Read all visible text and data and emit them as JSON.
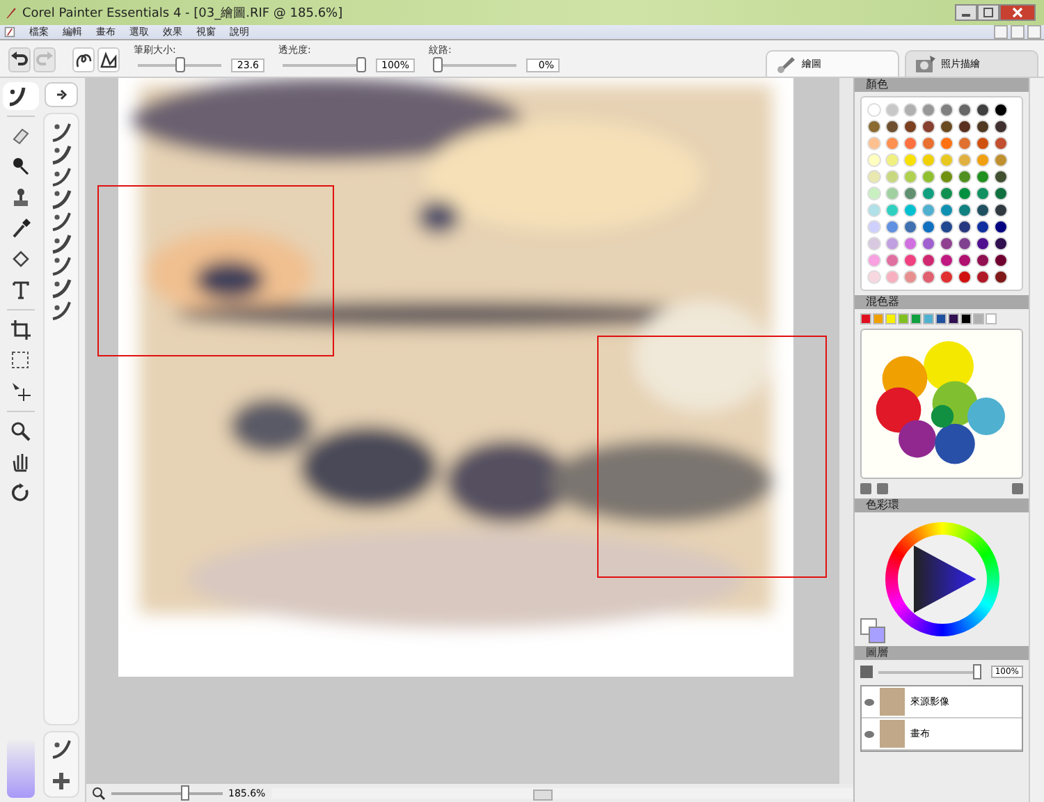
{
  "window": {
    "title": "Corel Painter Essentials 4 - [03_繪圖.RIF @ 185.6%]"
  },
  "menu": [
    "檔案",
    "編輯",
    "畫布",
    "選取",
    "效果",
    "視窗",
    "說明"
  ],
  "property_bar": [
    {
      "label": "筆刷大小:",
      "value": "23.6",
      "level": 0.5
    },
    {
      "label": "透光度:",
      "value": "100%",
      "level": 1
    },
    {
      "label": "紋路:",
      "value": "0%",
      "level": 0
    }
  ],
  "tabs": [
    {
      "label": "繪圖",
      "selected": true
    },
    {
      "label": "照片描繪",
      "selected": false
    }
  ],
  "colors_panel": {
    "title": "顏色",
    "rows": [
      [
        {
          "color": "#ffffff"
        },
        {
          "color": "#c8c8c8"
        },
        {
          "color": "#b0b0b0"
        },
        {
          "color": "#989898"
        },
        {
          "color": "#808080"
        },
        {
          "color": "#686868"
        },
        {
          "color": "#404040"
        },
        {
          "color": "#000000"
        }
      ],
      [
        {
          "color": "#8a6a30"
        },
        {
          "color": "#6e5030"
        },
        {
          "color": "#7a4020"
        },
        {
          "color": "#884030"
        },
        {
          "color": "#6a4a20"
        },
        {
          "color": "#5a3020"
        },
        {
          "color": "#503820"
        },
        {
          "color": "#403030"
        }
      ],
      [
        {
          "color": "#ffc090"
        },
        {
          "color": "#ff9050"
        },
        {
          "color": "#ff7040"
        },
        {
          "color": "#e87030"
        },
        {
          "color": "#ff7010"
        },
        {
          "color": "#e07030"
        },
        {
          "color": "#d05010"
        },
        {
          "color": "#c05030"
        }
      ],
      [
        {
          "color": "#ffffc0"
        },
        {
          "color": "#f0f080"
        },
        {
          "color": "#f8e000"
        },
        {
          "color": "#f0d000"
        },
        {
          "color": "#e8c820"
        },
        {
          "color": "#e0b040"
        },
        {
          "color": "#f0a010"
        },
        {
          "color": "#c09030"
        }
      ],
      [
        {
          "color": "#e8e8b0"
        },
        {
          "color": "#c8d880"
        },
        {
          "color": "#b0d050"
        },
        {
          "color": "#90c030"
        },
        {
          "color": "#709010"
        },
        {
          "color": "#509020"
        },
        {
          "color": "#209020"
        },
        {
          "color": "#405030"
        }
      ],
      [
        {
          "color": "#c8f0c0"
        },
        {
          "color": "#a0d0a0"
        },
        {
          "color": "#609070"
        },
        {
          "color": "#10a080"
        },
        {
          "color": "#109050"
        },
        {
          "color": "#009040"
        },
        {
          "color": "#109060"
        },
        {
          "color": "#107040"
        }
      ],
      [
        {
          "color": "#b0e0e8"
        },
        {
          "color": "#30d0c0"
        },
        {
          "color": "#00c0d0"
        },
        {
          "color": "#50b0d0"
        },
        {
          "color": "#1090b0"
        },
        {
          "color": "#108080"
        },
        {
          "color": "#205060"
        },
        {
          "color": "#303840"
        }
      ],
      [
        {
          "color": "#d0d0ff"
        },
        {
          "color": "#6090e0"
        },
        {
          "color": "#4070b0"
        },
        {
          "color": "#1070c0"
        },
        {
          "color": "#204890"
        },
        {
          "color": "#283880"
        },
        {
          "color": "#1030a0"
        },
        {
          "color": "#000080"
        }
      ],
      [
        {
          "color": "#d8c8e0"
        },
        {
          "color": "#c0a0e0"
        },
        {
          "color": "#d070e0"
        },
        {
          "color": "#a060d0"
        },
        {
          "color": "#904090"
        },
        {
          "color": "#804090"
        },
        {
          "color": "#501090"
        },
        {
          "color": "#301050"
        }
      ],
      [
        {
          "color": "#f8a0e0"
        },
        {
          "color": "#e070a0"
        },
        {
          "color": "#f04080"
        },
        {
          "color": "#d02870"
        },
        {
          "color": "#c01880"
        },
        {
          "color": "#b01070"
        },
        {
          "color": "#901050"
        },
        {
          "color": "#700030"
        }
      ],
      [
        {
          "color": "#f8d8e0"
        },
        {
          "color": "#f8b0c0"
        },
        {
          "color": "#e89090"
        },
        {
          "color": "#e06070"
        },
        {
          "color": "#e03030"
        },
        {
          "color": "#d01010"
        },
        {
          "color": "#b01828"
        },
        {
          "color": "#801818"
        }
      ]
    ]
  },
  "mixer_panel": {
    "title": "混色器",
    "swatches": [
      {
        "color": "#e01020"
      },
      {
        "color": "#f0a000"
      },
      {
        "color": "#f8f000"
      },
      {
        "color": "#80c020"
      },
      {
        "color": "#10a040"
      },
      {
        "color": "#50b0d0"
      },
      {
        "color": "#2050a0"
      },
      {
        "color": "#301050"
      },
      {
        "color": "#000000"
      },
      {
        "color": "#b0b0b0"
      },
      {
        "color": "#ffffff"
      }
    ]
  },
  "color_wheel_panel": {
    "title": "色彩環"
  },
  "layers_panel": {
    "title": "圖層",
    "opacity": {
      "value": "100%",
      "level": 1
    },
    "layers": [
      {
        "name": "來源影像",
        "selected": false
      },
      {
        "name": "畫布",
        "selected": false
      }
    ]
  },
  "status_bar": {
    "zoom": "185.6%",
    "level": 0.68
  }
}
